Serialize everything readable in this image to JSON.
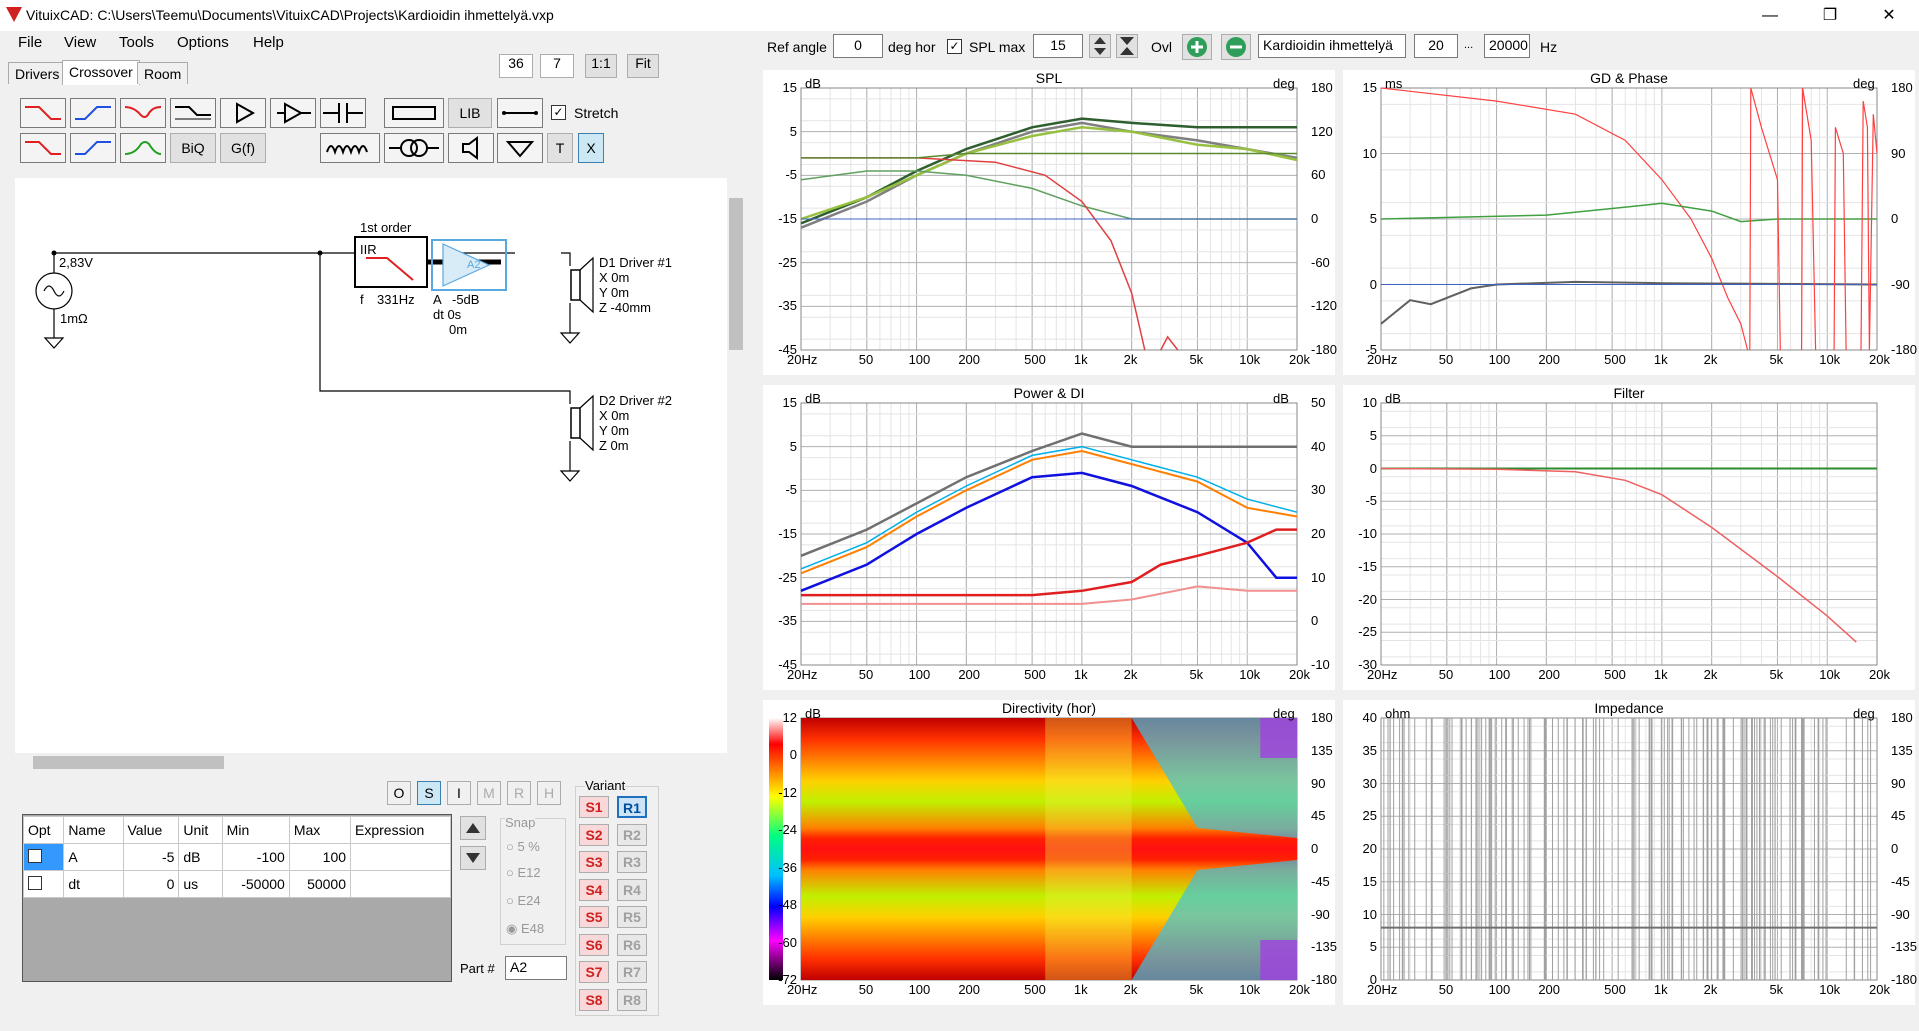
{
  "window": {
    "title": "VituixCAD: C:\\Users\\Teemu\\Documents\\VituixCAD\\Projects\\Kardioidin ihmettelyä.vxp",
    "min": "—",
    "max": "❐",
    "close": "✕"
  },
  "menu": [
    "File",
    "View",
    "Tools",
    "Options",
    "Help"
  ],
  "tabs": [
    "Drivers",
    "Crossover",
    "Room"
  ],
  "zoom": {
    "a": "36",
    "b": "7",
    "one": "1:1",
    "fit": "Fit"
  },
  "toolbar": {
    "lib": "LIB",
    "biq": "BiQ",
    "gf": "G(f)",
    "t": "T",
    "x": "X",
    "stretch": "Stretch"
  },
  "topbar": {
    "ref_angle_label": "Ref angle",
    "ref_angle": "0",
    "deg_hor": "deg hor",
    "spl_max_label": "SPL max",
    "spl_max": "15",
    "ovl": "Ovl",
    "project": "Kardioidin ihmettelyä",
    "f_min": "20",
    "dots": "...",
    "f_max": "20000",
    "hz": "Hz"
  },
  "schematic": {
    "source_v": "2,83V",
    "source_r": "1mΩ",
    "filter_order": "1st order",
    "filter_type": "IIR",
    "filter_f": "f",
    "filter_freq": "331Hz",
    "amp_label": "A2",
    "amp_a": "A",
    "amp_gain": "-5dB",
    "amp_dt": "dt 0s",
    "amp_z": "0m",
    "d1_name": "D1 Driver #1",
    "d1_x": "X 0m",
    "d1_y": "Y 0m",
    "d1_z": "Z -40mm",
    "d2_name": "D2 Driver #2",
    "d2_x": "X 0m",
    "d2_y": "Y 0m",
    "d2_z": "Z 0m"
  },
  "ostabs": [
    "O",
    "S",
    "I",
    "M",
    "R",
    "H"
  ],
  "param_table": {
    "headers": [
      "Opt",
      "Name",
      "Value",
      "Unit",
      "Min",
      "Max",
      "Expression"
    ],
    "rows": [
      [
        "",
        "A",
        "-5",
        "dB",
        "-100",
        "100",
        ""
      ],
      [
        "",
        "dt",
        "0",
        "us",
        "-50000",
        "50000",
        ""
      ]
    ]
  },
  "snap": {
    "label": "Snap",
    "options": [
      "5 %",
      "E12",
      "E24",
      "E48"
    ]
  },
  "part": {
    "label": "Part #",
    "value": "A2"
  },
  "variant": {
    "label": "Variant",
    "s": [
      "S1",
      "S2",
      "S3",
      "S4",
      "S5",
      "S6",
      "S7",
      "S8"
    ],
    "r": [
      "R1",
      "R2",
      "R3",
      "R4",
      "R5",
      "R6",
      "R7",
      "R8"
    ]
  },
  "freq_ticks": [
    "20Hz",
    "50",
    "100",
    "200",
    "500",
    "1k",
    "2k",
    "5k",
    "10k",
    "20k"
  ],
  "charts": {
    "spl": {
      "title": "SPL",
      "left_unit": "dB",
      "right_unit": "deg",
      "left": [
        "15",
        "5",
        "-5",
        "-15",
        "-25",
        "-35",
        "-45"
      ],
      "right": [
        "180",
        "120",
        "60",
        "0",
        "-60",
        "-120",
        "-180"
      ]
    },
    "gd": {
      "title": "GD & Phase",
      "left_unit": "ms",
      "right_unit": "deg",
      "left": [
        "15",
        "10",
        "5",
        "0",
        "-5"
      ],
      "right": [
        "180",
        "90",
        "0",
        "-90",
        "-180"
      ]
    },
    "power": {
      "title": "Power & DI",
      "left_unit": "dB",
      "right_unit": "dB",
      "left": [
        "15",
        "5",
        "-5",
        "-15",
        "-25",
        "-35",
        "-45"
      ],
      "right": [
        "50",
        "40",
        "30",
        "20",
        "10",
        "0",
        "-10"
      ]
    },
    "filter": {
      "title": "Filter",
      "left_unit": "dB",
      "left": [
        "10",
        "5",
        "0",
        "-5",
        "-10",
        "-15",
        "-20",
        "-25",
        "-30"
      ]
    },
    "directivity": {
      "title": "Directivity (hor)",
      "left_unit": "dB",
      "right_unit": "deg",
      "left": [
        "12",
        "0",
        "-12",
        "-24",
        "-36",
        "-48",
        "-60",
        "-72"
      ],
      "right": [
        "180",
        "135",
        "90",
        "45",
        "0",
        "-45",
        "-90",
        "-135",
        "-180"
      ]
    },
    "impedance": {
      "title": "Impedance",
      "left_unit": "ohm",
      "right_unit": "deg",
      "left": [
        "40",
        "35",
        "30",
        "25",
        "20",
        "15",
        "10",
        "5",
        "0"
      ],
      "right": [
        "180",
        "135",
        "90",
        "45",
        "0",
        "-45",
        "-90",
        "-135",
        "-180"
      ]
    }
  }
}
